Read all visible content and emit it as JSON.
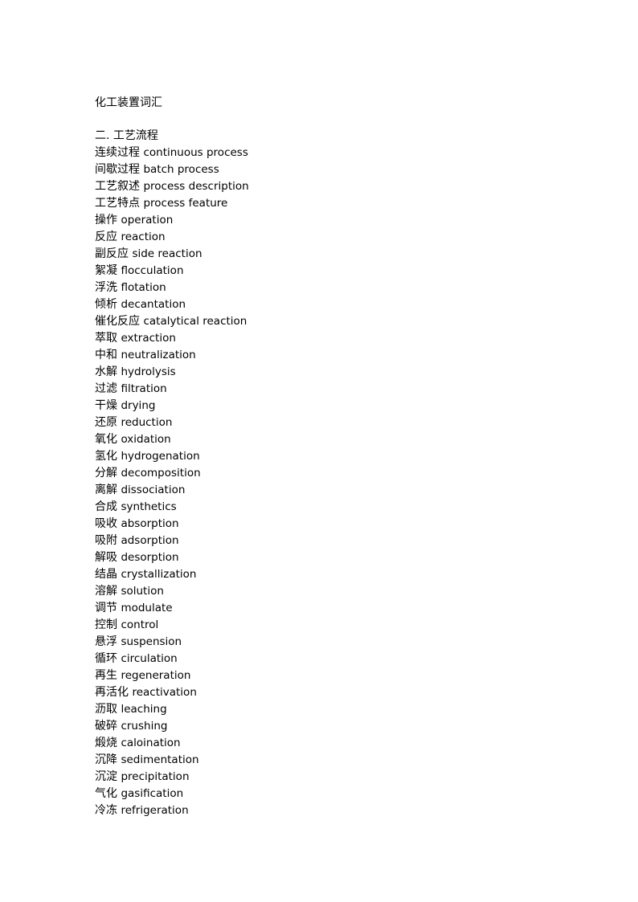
{
  "document": {
    "title": "化工装置词汇",
    "section_heading": "二. 工艺流程",
    "entries": [
      {
        "zh": "连续过程",
        "en": "continuous process"
      },
      {
        "zh": "间歇过程",
        "en": "batch process"
      },
      {
        "zh": "工艺叙述",
        "en": "process description"
      },
      {
        "zh": "工艺特点",
        "en": "process feature"
      },
      {
        "zh": "操作",
        "en": "operation"
      },
      {
        "zh": "反应",
        "en": "reaction"
      },
      {
        "zh": "副反应",
        "en": "side reaction"
      },
      {
        "zh": "絮凝",
        "en": "flocculation"
      },
      {
        "zh": "浮洗",
        "en": "flotation"
      },
      {
        "zh": "倾析",
        "en": "decantation"
      },
      {
        "zh": "催化反应",
        "en": "catalytical reaction"
      },
      {
        "zh": "萃取",
        "en": "extraction"
      },
      {
        "zh": "中和",
        "en": "neutralization"
      },
      {
        "zh": "水解",
        "en": "hydrolysis"
      },
      {
        "zh": "过滤",
        "en": "filtration"
      },
      {
        "zh": "干燥",
        "en": "drying"
      },
      {
        "zh": "还原",
        "en": "reduction"
      },
      {
        "zh": "氧化",
        "en": "oxidation"
      },
      {
        "zh": "氢化",
        "en": "hydrogenation"
      },
      {
        "zh": "分解",
        "en": "decomposition"
      },
      {
        "zh": "离解",
        "en": "dissociation"
      },
      {
        "zh": "合成",
        "en": "synthetics"
      },
      {
        "zh": "吸收",
        "en": "absorption"
      },
      {
        "zh": "吸附",
        "en": "adsorption"
      },
      {
        "zh": "解吸",
        "en": "desorption"
      },
      {
        "zh": "结晶",
        "en": "crystallization"
      },
      {
        "zh": "溶解",
        "en": "solution"
      },
      {
        "zh": "调节",
        "en": "modulate"
      },
      {
        "zh": "控制",
        "en": "control"
      },
      {
        "zh": "悬浮",
        "en": "suspension"
      },
      {
        "zh": "循环",
        "en": "circulation"
      },
      {
        "zh": "再生",
        "en": "regeneration"
      },
      {
        "zh": "再活化",
        "en": "reactivation"
      },
      {
        "zh": "沥取",
        "en": "leaching"
      },
      {
        "zh": "破碎",
        "en": "crushing"
      },
      {
        "zh": "煅烧",
        "en": "caloination"
      },
      {
        "zh": "沉降",
        "en": "sedimentation"
      },
      {
        "zh": "沉淀",
        "en": "precipitation"
      },
      {
        "zh": "气化",
        "en": "gasification"
      },
      {
        "zh": "冷冻",
        "en": "refrigeration"
      }
    ]
  }
}
